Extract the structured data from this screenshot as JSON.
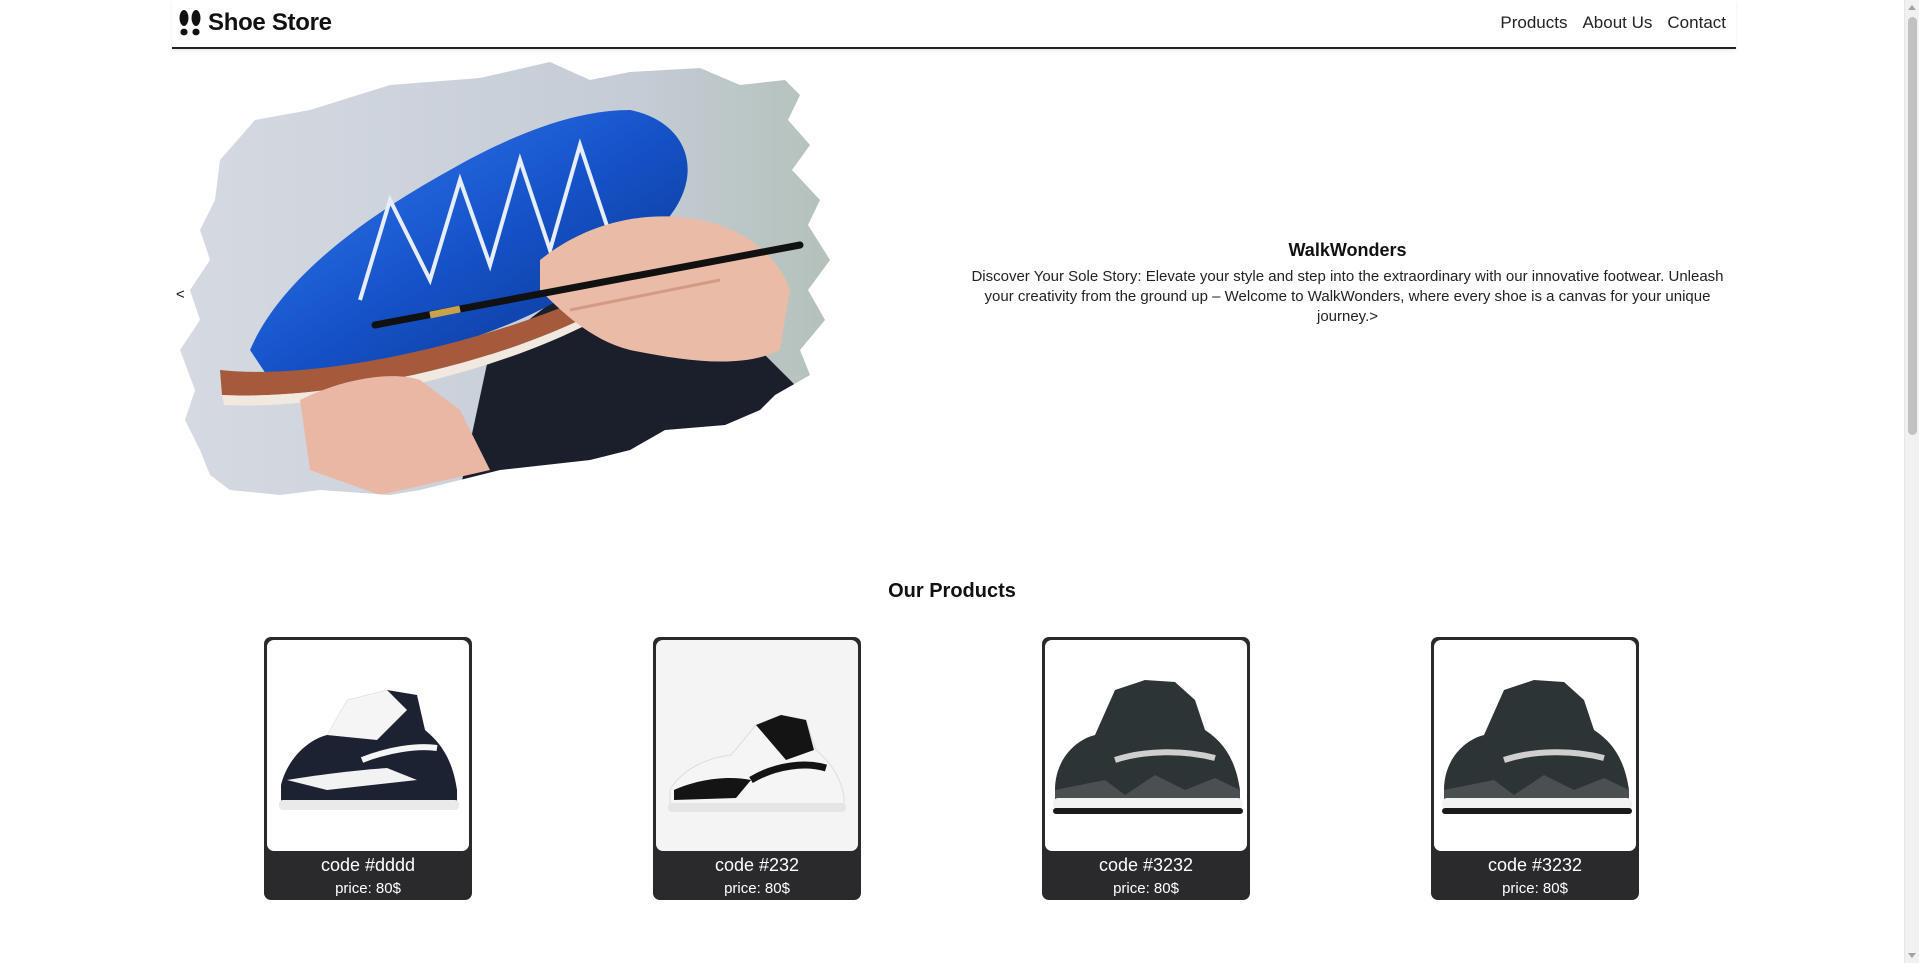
{
  "header": {
    "brand": "Shoe Store",
    "nav": [
      "Products",
      "About Us",
      "Contact"
    ]
  },
  "hero": {
    "prev": "<",
    "title": "WalkWonders",
    "description": "Discover Your Sole Story: Elevate your style and step into the extraordinary with our innovative footwear. Unleash your creativity from the ground up – Welcome to WalkWonders, where every shoe is a canvas for your unique journey.",
    "next": ">"
  },
  "products": {
    "title": "Our Products",
    "items": [
      {
        "code": "code #dddd",
        "price": "price: 80$"
      },
      {
        "code": "code #232",
        "price": "price: 80$"
      },
      {
        "code": "code #3232",
        "price": "price: 80$"
      },
      {
        "code": "code #3232",
        "price": "price: 80$"
      }
    ]
  },
  "colors": {
    "card_bg": "#2a2a2d",
    "hero_shoe": "#1f5fd6",
    "header_border": "#222222"
  }
}
